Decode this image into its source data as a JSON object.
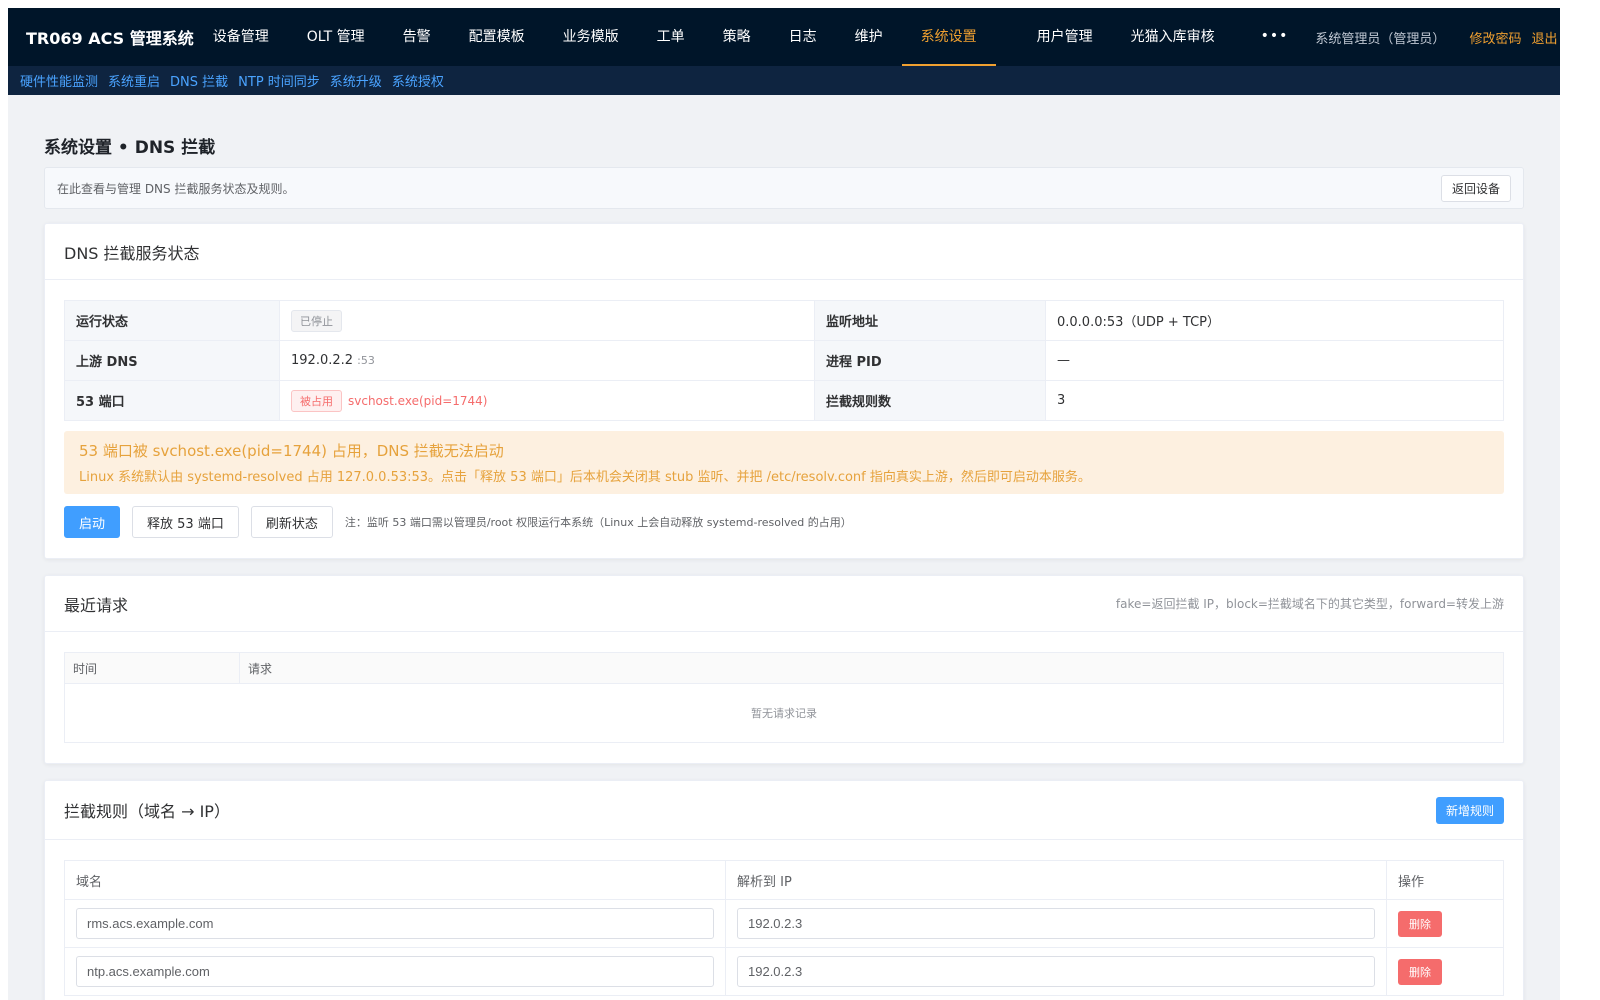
{
  "app": {
    "title": "TR069 ACS 管理系统"
  },
  "nav": {
    "items": [
      "设备管理",
      "OLT 管理",
      "告警",
      "配置模板",
      "业务模版",
      "工单",
      "策略",
      "日志",
      "维护",
      "系统设置"
    ],
    "items2": [
      "用户管理",
      "光猫入库审核"
    ],
    "more": "•••",
    "user": "系统管理员（管理员）",
    "change_password": "修改密码",
    "logout": "退出"
  },
  "subnav": [
    "硬件性能监测",
    "系统重启",
    "DNS 拦截",
    "NTP 时间同步",
    "系统升级",
    "系统授权"
  ],
  "page": {
    "title": "系统设置 • DNS 拦截",
    "intro": "在此查看与管理 DNS 拦截服务状态及规则。",
    "back_button": "返回设备"
  },
  "status_card": {
    "title": "DNS 拦截服务状态",
    "rows": {
      "run_label": "运行状态",
      "run_value": "已停止",
      "listen_label": "监听地址",
      "listen_value": "0.0.0.0:53（UDP + TCP）",
      "upstream_label": "上游 DNS",
      "upstream_value": "192.0.2.2",
      "upstream_port": ":53",
      "pid_label": "进程 PID",
      "pid_value": "—",
      "port_label": "53 端口",
      "port_tag": "被占用",
      "port_process": "svchost.exe(pid=1744)",
      "rules_label": "拦截规则数",
      "rules_value": "3"
    },
    "alert": {
      "title": "53 端口被 svchost.exe(pid=1744) 占用，DNS 拦截无法启动",
      "desc": "Linux 系统默认由 systemd-resolved 占用 127.0.0.53:53。点击「释放 53 端口」后本机会关闭其 stub 监听、并把 /etc/resolv.conf 指向真实上游，然后即可启动本服务。"
    },
    "buttons": {
      "start": "启动",
      "release": "释放 53 端口",
      "refresh": "刷新状态"
    },
    "note": "注：监听 53 端口需以管理员/root 权限运行本系统（Linux 上会自动释放 systemd-resolved 的占用）"
  },
  "requests_card": {
    "title": "最近请求",
    "legend": "fake=返回拦截 IP，block=拦截域名下的其它类型，forward=转发上游",
    "columns": [
      "时间",
      "请求"
    ],
    "empty": "暂无请求记录"
  },
  "rules_card": {
    "title": "拦截规则（域名 → IP）",
    "add_button": "新增规则",
    "columns": [
      "域名",
      "解析到 IP",
      "操作"
    ],
    "rows": [
      {
        "domain": "rms.acs.example.com",
        "ip": "192.0.2.3",
        "action": "删除"
      },
      {
        "domain": "ntp.acs.example.com",
        "ip": "192.0.2.3",
        "action": "删除"
      }
    ]
  }
}
